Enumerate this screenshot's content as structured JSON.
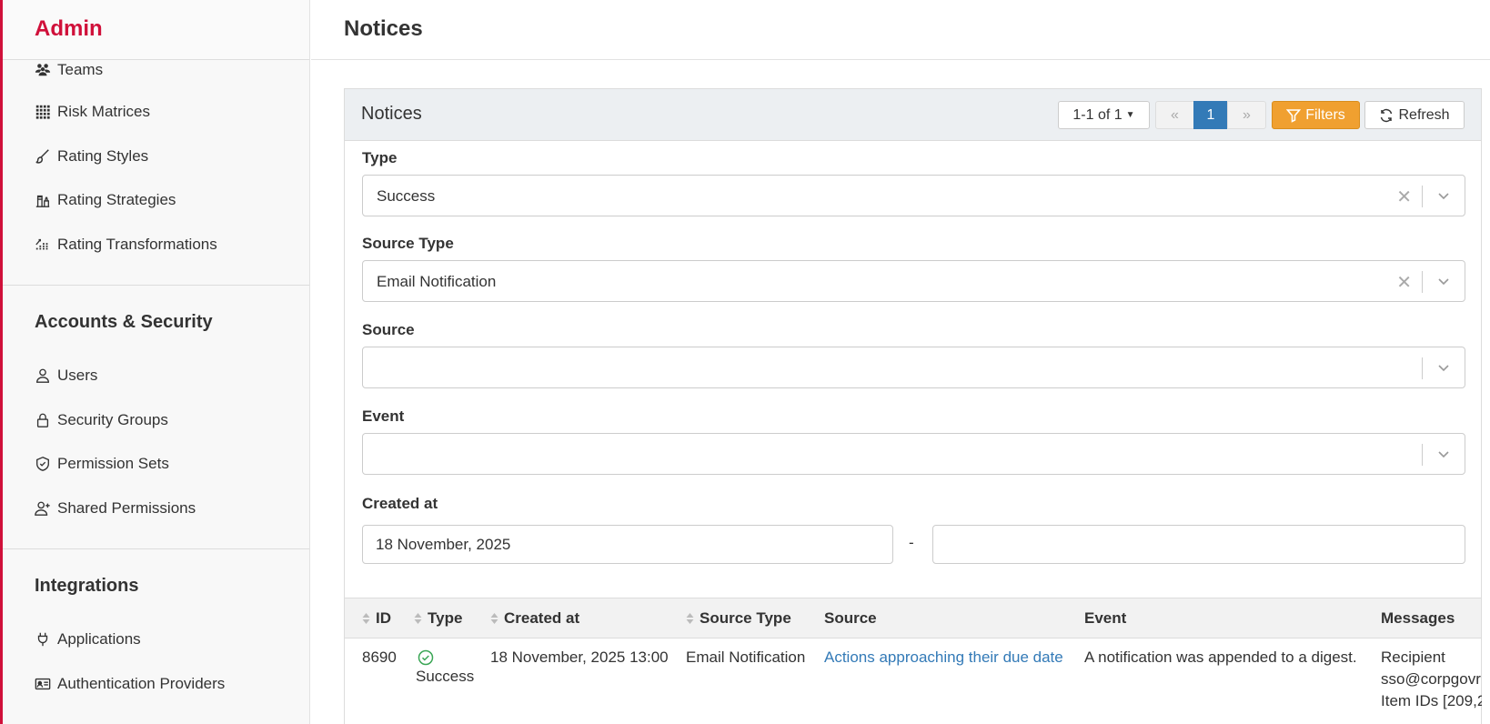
{
  "brand": "Admin",
  "page_title": "Notices",
  "sidebar": {
    "items_top": [
      {
        "label": "Teams",
        "icon": "teams-icon"
      },
      {
        "label": "Risk Matrices",
        "icon": "grid-icon"
      },
      {
        "label": "Rating Styles",
        "icon": "brush-icon"
      },
      {
        "label": "Rating Strategies",
        "icon": "chess-icon"
      },
      {
        "label": "Rating Transformations",
        "icon": "transform-icon"
      }
    ],
    "section_accounts": "Accounts & Security",
    "items_accounts": [
      {
        "label": "Users",
        "icon": "user-icon"
      },
      {
        "label": "Security Groups",
        "icon": "lock-icon"
      },
      {
        "label": "Permission Sets",
        "icon": "shield-icon"
      },
      {
        "label": "Shared Permissions",
        "icon": "user-plus-icon"
      }
    ],
    "section_integrations": "Integrations",
    "items_integrations": [
      {
        "label": "Applications",
        "icon": "plug-icon"
      },
      {
        "label": "Authentication Providers",
        "icon": "id-card-icon"
      }
    ]
  },
  "panel": {
    "title": "Notices",
    "pager_label": "1-1 of 1",
    "prev": "«",
    "current_page": "1",
    "next": "»",
    "filters_label": "Filters",
    "refresh_label": "Refresh"
  },
  "filters": {
    "type_label": "Type",
    "type_value": "Success",
    "source_type_label": "Source Type",
    "source_type_value": "Email Notification",
    "source_label": "Source",
    "source_value": "",
    "event_label": "Event",
    "event_value": "",
    "created_label": "Created at",
    "created_from": "18 November, 2025",
    "created_to": "",
    "range_sep": "-"
  },
  "table": {
    "columns": [
      "ID",
      "Type",
      "Created at",
      "Source Type",
      "Source",
      "Event",
      "Messages"
    ],
    "rows": [
      {
        "id": "8690",
        "type": "Success",
        "created_at": "18 November, 2025 13:00",
        "source_type": "Email Notification",
        "source": "Actions approaching their due date",
        "event": "A notification was appended to a digest.",
        "messages": [
          "Recipient",
          "sso@corpgovr",
          "Item IDs [209,2"
        ]
      }
    ]
  },
  "colors": {
    "brand_red": "#d0103a",
    "primary_blue": "#337ab7",
    "filters_orange": "#f0a030",
    "success_green": "#3aa655"
  }
}
